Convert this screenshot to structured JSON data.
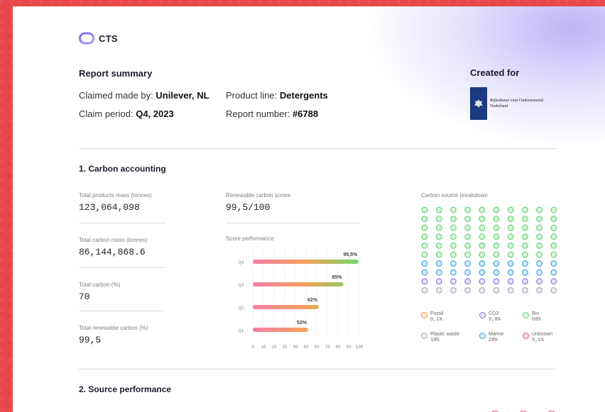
{
  "brand": {
    "name": "CTS"
  },
  "summary": {
    "title": "Report summary",
    "claimed_label": "Claimed made by: ",
    "claimed_value": "Unilever, NL",
    "product_label": "Product line: ",
    "product_value": "Detergents",
    "period_label": "Claim period: ",
    "period_value": "Q4, 2023",
    "report_label": "Report number: ",
    "report_value": "#6788"
  },
  "created_for": {
    "title": "Created for",
    "org_line1": "Rijksdienst voor Ondernemend",
    "org_line2": "Nederland"
  },
  "section1": {
    "title": "1. Carbon accounting",
    "stats": [
      {
        "label": "Total products mass (tonnes)",
        "value": "123,064,098"
      },
      {
        "label": "Total carbon mass (tonnes)",
        "value": "86,144,868.6"
      },
      {
        "label": "Total carbon (%)",
        "value": "70"
      },
      {
        "label": "Total renewable carbon (%)",
        "value": "99,5"
      }
    ],
    "renewable_label": "Renewable carbon scrore",
    "renewable_value": "99,5/100",
    "breakdown_label": "Carbon source breakdown"
  },
  "chart_data": {
    "type": "bar",
    "orientation": "horizontal",
    "title": "Score performance",
    "categories": [
      "Q4",
      "Q3",
      "Q2",
      "Q1"
    ],
    "values": [
      99.5,
      85,
      62,
      52
    ],
    "data_labels": [
      "99,5%",
      "85%",
      "62%",
      "52%"
    ],
    "xlim": [
      0,
      100
    ],
    "xticks": [
      "0",
      "10",
      "20",
      "30",
      "40",
      "50",
      "60",
      "70",
      "80",
      "90",
      "100"
    ],
    "grid": true,
    "gradient": [
      "#f47fa6",
      "#f5a05a",
      "#6dd96a"
    ]
  },
  "breakdown": {
    "grid_rows": [
      [
        "bio",
        "bio",
        "bio",
        "bio",
        "bio",
        "bio",
        "bio",
        "bio",
        "bio",
        "bio"
      ],
      [
        "bio",
        "bio",
        "bio",
        "bio",
        "bio",
        "bio",
        "bio",
        "bio",
        "bio",
        "bio"
      ],
      [
        "bio",
        "bio",
        "bio",
        "bio",
        "bio",
        "bio",
        "bio",
        "bio",
        "bio",
        "bio"
      ],
      [
        "bio",
        "bio",
        "bio",
        "bio",
        "bio",
        "bio",
        "bio",
        "bio",
        "bio",
        "bio"
      ],
      [
        "bio",
        "bio",
        "bio",
        "bio",
        "bio",
        "bio",
        "bio",
        "bio",
        "bio",
        "bio"
      ],
      [
        "bio",
        "bio",
        "bio",
        "bio",
        "bio",
        "bio",
        "bio",
        "bio",
        "bio",
        "bio"
      ],
      [
        "marine",
        "marine",
        "marine",
        "marine",
        "marine",
        "marine",
        "marine",
        "marine",
        "marine",
        "marine"
      ],
      [
        "marine",
        "marine",
        "marine",
        "marine",
        "marine",
        "marine",
        "marine",
        "marine",
        "marine",
        "marine"
      ],
      [
        "co2",
        "co2",
        "co2",
        "co2",
        "co2",
        "co2",
        "co2",
        "co2",
        "co2",
        "co2"
      ],
      [
        "plastic",
        "plastic",
        "plastic",
        "plastic",
        "plastic",
        "plastic",
        "plastic",
        "plastic",
        "plastic",
        "plastic"
      ]
    ],
    "colors": {
      "fossil": "#f39a4a",
      "co2": "#8b74e4",
      "bio": "#5fd36b",
      "plastic": "#a9a7bd",
      "marine": "#3aa3e0",
      "unknown": "#e8507a"
    },
    "legend": [
      {
        "key": "fossil",
        "name": "Fossil",
        "value": "0,1%"
      },
      {
        "key": "co2",
        "name": "CO2",
        "value": "9,8%"
      },
      {
        "key": "bio",
        "name": "Bio",
        "value": "60%"
      },
      {
        "key": "plastic",
        "name": "Plastic waste",
        "value": "10%"
      },
      {
        "key": "marine",
        "name": "Marine",
        "value": "20%"
      },
      {
        "key": "unknown",
        "name": "Unknown",
        "value": "0,1%"
      }
    ]
  },
  "section2": {
    "title": "2. Source performance"
  }
}
